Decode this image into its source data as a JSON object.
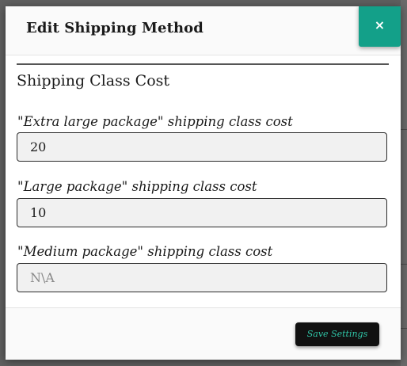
{
  "modal": {
    "title": "Edit Shipping Method",
    "close_label": "×"
  },
  "section": {
    "title": "Shipping Class Cost"
  },
  "fields": [
    {
      "label": "\"Extra large package\" shipping class cost",
      "value": "20",
      "placeholder": ""
    },
    {
      "label": "\"Large package\" shipping class cost",
      "value": "10",
      "placeholder": ""
    },
    {
      "label": "\"Medium package\" shipping class cost",
      "value": "",
      "placeholder": "N\\A"
    }
  ],
  "footer": {
    "save_label": "Save Settings"
  },
  "colors": {
    "accent": "#13a089",
    "save_button_bg": "#111111",
    "save_button_text": "#2fc4a6",
    "input_bg": "#f1f1f1",
    "backdrop": "#5f5f5f"
  }
}
